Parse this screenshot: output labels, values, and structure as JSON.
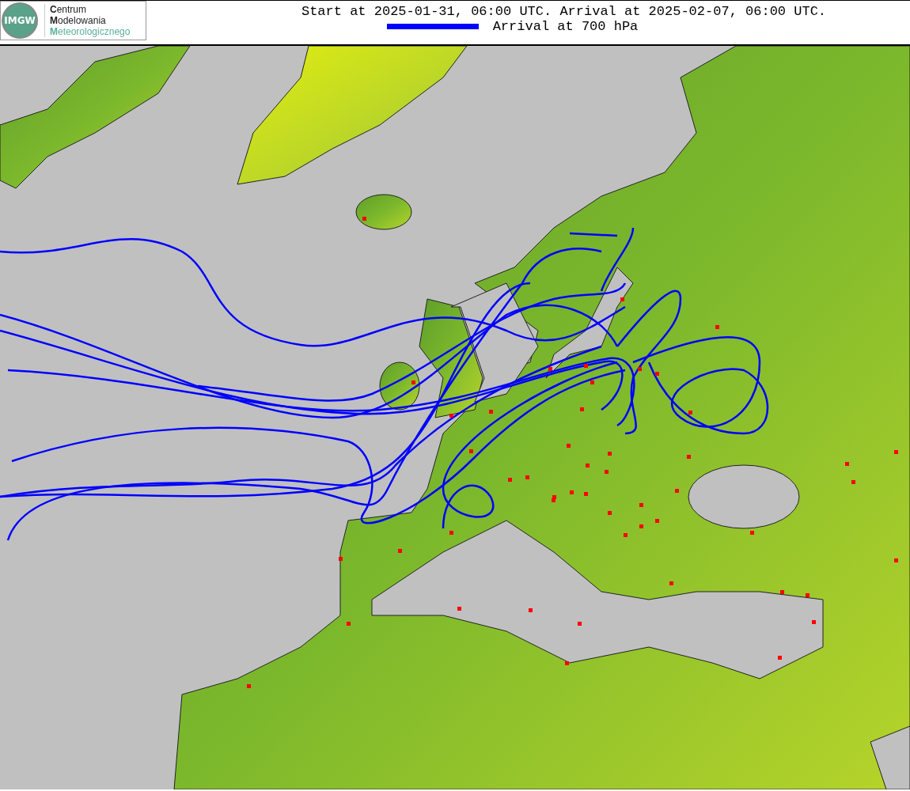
{
  "logo": {
    "emblem_text": "IMGW",
    "org_name": [
      "**C**entrum",
      "**M**odelowania",
      "**M**eteorologicznego"
    ]
  },
  "header": {
    "title": "Start at 2025-01-31, 06:00 UTC. Arrival at 2025-02-07, 06:00 UTC.",
    "legend": [
      {
        "label": "Arrival at 700 hPa",
        "color": "#0000ff"
      }
    ]
  }
}
